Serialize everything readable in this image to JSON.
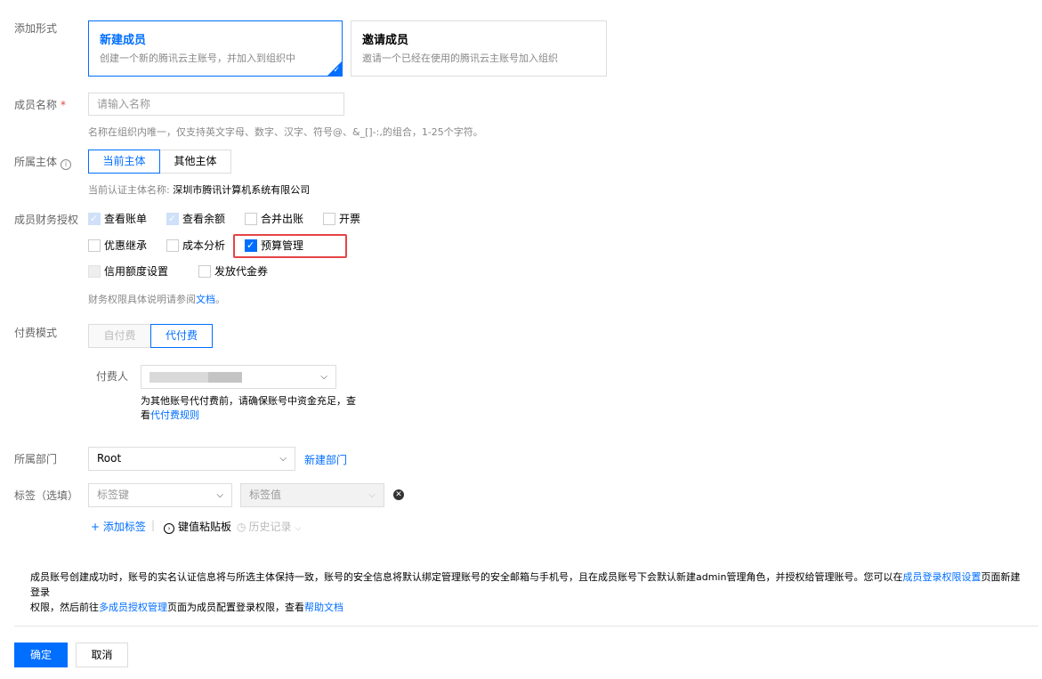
{
  "labels": {
    "add_type": "添加形式",
    "member_name": "成员名称",
    "entity": "所属主体",
    "finance_perm": "成员财务授权",
    "pay_mode": "付费模式",
    "payer": "付费人",
    "department": "所属部门",
    "tags": "标签（选填）"
  },
  "cards": [
    {
      "title": "新建成员",
      "desc": "创建一个新的腾讯云主账号，并加入到组织中",
      "selected": true
    },
    {
      "title": "邀请成员",
      "desc": "邀请一个已经在使用的腾讯云主账号加入组织",
      "selected": false
    }
  ],
  "member_name": {
    "placeholder": "请输入名称",
    "hint": "名称在组织内唯一，仅支持英文字母、数字、汉字、符号@、&_[]-:,的组合，1-25个字符。"
  },
  "entity": {
    "options": [
      "当前主体",
      "其他主体"
    ],
    "selected": "当前主体",
    "current_prefix": "当前认证主体名称: ",
    "current_name": "深圳市腾讯计算机系统有限公司"
  },
  "finance": {
    "options": [
      {
        "label": "查看账单",
        "state": "checked-disabled"
      },
      {
        "label": "查看余额",
        "state": "checked-disabled"
      },
      {
        "label": "合并出账",
        "state": "unchecked"
      },
      {
        "label": "开票",
        "state": "unchecked"
      },
      {
        "label": "优惠继承",
        "state": "unchecked"
      },
      {
        "label": "成本分析",
        "state": "unchecked"
      },
      {
        "label": "预算管理",
        "state": "checked"
      },
      {
        "label": "信用额度设置",
        "state": "unchecked-disabled"
      },
      {
        "label": "发放代金券",
        "state": "unchecked"
      }
    ],
    "note_prefix": "财务权限具体说明请参阅",
    "note_link": "文档",
    "note_suffix": "。"
  },
  "pay_mode": {
    "options": [
      "自付费",
      "代付费"
    ],
    "selected": "代付费",
    "payer_hint_line1": "为其他账号代付费前，请确保账号中资金充足，查",
    "payer_hint_line2_prefix": "看",
    "payer_hint_link": "代付费规则"
  },
  "department": {
    "value": "Root",
    "new_link": "新建部门"
  },
  "tags": {
    "key_placeholder": "标签键",
    "value_placeholder": "标签值",
    "add_link": "添加标签",
    "clipboard": "键值粘贴板",
    "history": "历史记录"
  },
  "notice": {
    "part1": "成员账号创建成功时，账号的实名认证信息将与所选主体保持一致，账号的安全信息将默认绑定管理账号的安全邮箱与手机号，且在成员账号下会默认新建admin管理角色，并授权给管理账号。您可以在",
    "link1": "成员登录权限设置",
    "part2": "页面新建登录",
    "part3": "权限，然后前往",
    "link2": "多成员授权管理",
    "part4": "页面为成员配置登录权限，查看",
    "link3": "帮助文档"
  },
  "buttons": {
    "confirm": "确定",
    "cancel": "取消"
  },
  "colors": {
    "primary": "#006eff",
    "highlight": "#e54545"
  }
}
